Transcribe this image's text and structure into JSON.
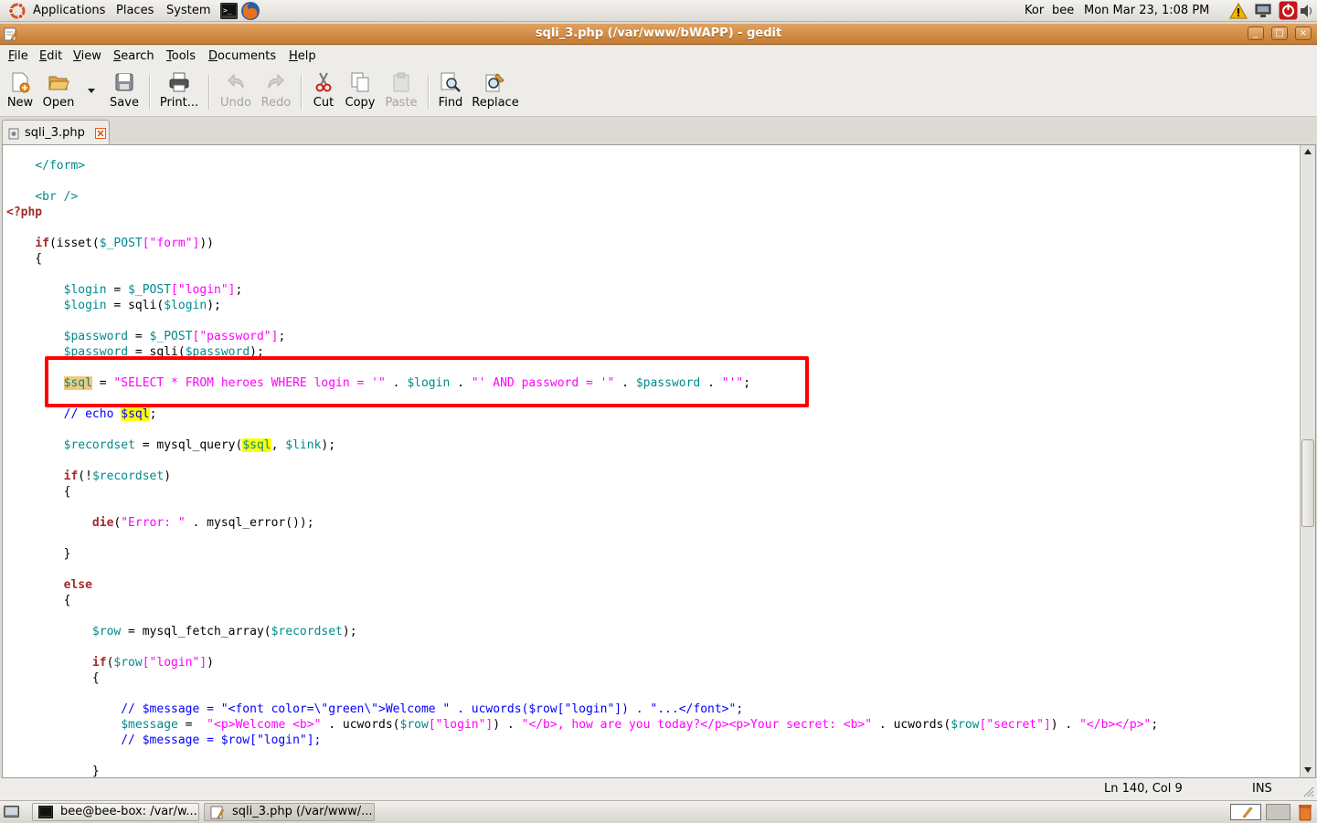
{
  "top_panel": {
    "menus": [
      "Applications",
      "Places",
      "System"
    ],
    "user_lang": "Kor",
    "user": "bee",
    "clock": "Mon Mar 23,  1:08 PM"
  },
  "window": {
    "title": "sqli_3.php (/var/www/bWAPP) - gedit",
    "buttons": [
      "_",
      "□",
      "×"
    ]
  },
  "menubar": [
    {
      "ul": "F",
      "rest": "ile"
    },
    {
      "ul": "E",
      "rest": "dit"
    },
    {
      "ul": "V",
      "rest": "iew"
    },
    {
      "ul": "S",
      "rest": "earch"
    },
    {
      "ul": "T",
      "rest": "ools"
    },
    {
      "ul": "D",
      "rest": "ocuments"
    },
    {
      "ul": "H",
      "rest": "elp"
    }
  ],
  "toolbar": {
    "new": "New",
    "open": "Open",
    "save": "Save",
    "print": "Print...",
    "undo": "Undo",
    "redo": "Redo",
    "cut": "Cut",
    "copy": "Copy",
    "paste": "Paste",
    "find": "Find",
    "replace": "Replace"
  },
  "tab": {
    "label": "sqli_3.php"
  },
  "code_lines": [
    [
      {
        "t": "    "
      },
      {
        "c": "tag",
        "t": "</form>"
      }
    ],
    [],
    [
      {
        "t": "    "
      },
      {
        "c": "tag",
        "t": "<br />"
      }
    ],
    [
      {
        "c": "php",
        "t": "<?php"
      }
    ],
    [],
    [
      {
        "t": "    "
      },
      {
        "c": "kw",
        "t": "if"
      },
      {
        "t": "(isset("
      },
      {
        "c": "var",
        "t": "$_POST"
      },
      {
        "c": "str",
        "t": "[\"form\"]"
      },
      {
        "t": "))"
      }
    ],
    [
      {
        "t": "    {"
      }
    ],
    [],
    [
      {
        "t": "        "
      },
      {
        "c": "var",
        "t": "$login"
      },
      {
        "t": " = "
      },
      {
        "c": "var",
        "t": "$_POST"
      },
      {
        "c": "str",
        "t": "[\"login\"]"
      },
      {
        "t": ";"
      }
    ],
    [
      {
        "t": "        "
      },
      {
        "c": "var",
        "t": "$login"
      },
      {
        "t": " = sqli("
      },
      {
        "c": "var",
        "t": "$login"
      },
      {
        "t": ");"
      }
    ],
    [],
    [
      {
        "t": "        "
      },
      {
        "c": "var",
        "t": "$password"
      },
      {
        "t": " = "
      },
      {
        "c": "var",
        "t": "$_POST"
      },
      {
        "c": "str",
        "t": "[\"password\"]"
      },
      {
        "t": ";"
      }
    ],
    [
      {
        "t": "        "
      },
      {
        "c": "var",
        "t": "$password"
      },
      {
        "t": " = sqli("
      },
      {
        "c": "var",
        "t": "$password"
      },
      {
        "t": ");"
      }
    ],
    [],
    [
      {
        "t": "        "
      },
      {
        "c": "var hl2",
        "t": "$sql"
      },
      {
        "t": " = "
      },
      {
        "c": "str",
        "t": "\"SELECT * FROM heroes WHERE login = '\""
      },
      {
        "t": " . "
      },
      {
        "c": "var",
        "t": "$login"
      },
      {
        "t": " . "
      },
      {
        "c": "str",
        "t": "\"' AND password = '\""
      },
      {
        "t": " . "
      },
      {
        "c": "var",
        "t": "$password"
      },
      {
        "t": " . "
      },
      {
        "c": "str",
        "t": "\"'\""
      },
      {
        "t": ";"
      }
    ],
    [],
    [
      {
        "t": "        "
      },
      {
        "c": "cmt",
        "t": "// echo "
      },
      {
        "c": "cmt hl",
        "t": "$sql"
      },
      {
        "t": ";"
      }
    ],
    [],
    [
      {
        "t": "        "
      },
      {
        "c": "var",
        "t": "$recordset"
      },
      {
        "t": " = mysql_query("
      },
      {
        "c": "var hl",
        "t": "$sql"
      },
      {
        "t": ", "
      },
      {
        "c": "var",
        "t": "$link"
      },
      {
        "t": ");"
      }
    ],
    [],
    [
      {
        "t": "        "
      },
      {
        "c": "kw",
        "t": "if"
      },
      {
        "t": "(!"
      },
      {
        "c": "var",
        "t": "$recordset"
      },
      {
        "t": ")"
      }
    ],
    [
      {
        "t": "        {"
      }
    ],
    [],
    [
      {
        "t": "            "
      },
      {
        "c": "kw",
        "t": "die"
      },
      {
        "t": "("
      },
      {
        "c": "str",
        "t": "\"Error: \""
      },
      {
        "t": " . mysql_error());"
      }
    ],
    [],
    [
      {
        "t": "        }"
      }
    ],
    [],
    [
      {
        "t": "        "
      },
      {
        "c": "kw",
        "t": "else"
      }
    ],
    [
      {
        "t": "        {"
      }
    ],
    [],
    [
      {
        "t": "            "
      },
      {
        "c": "var",
        "t": "$row"
      },
      {
        "t": " = mysql_fetch_array("
      },
      {
        "c": "var",
        "t": "$recordset"
      },
      {
        "t": ");"
      }
    ],
    [],
    [
      {
        "t": "            "
      },
      {
        "c": "kw",
        "t": "if"
      },
      {
        "t": "("
      },
      {
        "c": "var",
        "t": "$row"
      },
      {
        "c": "str",
        "t": "[\"login\"]"
      },
      {
        "t": ")"
      }
    ],
    [
      {
        "t": "            {"
      }
    ],
    [],
    [
      {
        "t": "                "
      },
      {
        "c": "cmt",
        "t": "// $message = \"<font color=\\\"green\\\">Welcome \" . ucwords($row[\"login\"]) . \"...</font>\";"
      }
    ],
    [
      {
        "t": "                "
      },
      {
        "c": "var",
        "t": "$message"
      },
      {
        "t": " =  "
      },
      {
        "c": "str",
        "t": "\"<p>Welcome <b>\""
      },
      {
        "t": " . ucwords("
      },
      {
        "c": "var",
        "t": "$row"
      },
      {
        "c": "str",
        "t": "[\"login\"]"
      },
      {
        "t": ") . "
      },
      {
        "c": "str",
        "t": "\"</b>, how are you today?</p><p>Your secret: <b>\""
      },
      {
        "t": " . ucwords("
      },
      {
        "c": "var",
        "t": "$row"
      },
      {
        "c": "str",
        "t": "[\"secret\"]"
      },
      {
        "t": ") . "
      },
      {
        "c": "str",
        "t": "\"</b></p>\""
      },
      {
        "t": ";"
      }
    ],
    [
      {
        "t": "                "
      },
      {
        "c": "cmt",
        "t": "// $message = $row[\"login\"];"
      }
    ],
    [],
    [
      {
        "t": "            }"
      }
    ]
  ],
  "statusbar": {
    "position": "Ln 140, Col 9",
    "mode": "INS"
  },
  "taskbar": {
    "items": [
      "bee@bee-box: /var/w...",
      "sqli_3.php (/var/www/..."
    ]
  },
  "colors": {
    "title_orange": "#d48b45",
    "highlight_box": "#ff0000",
    "search_highlight": "#ffff00"
  }
}
